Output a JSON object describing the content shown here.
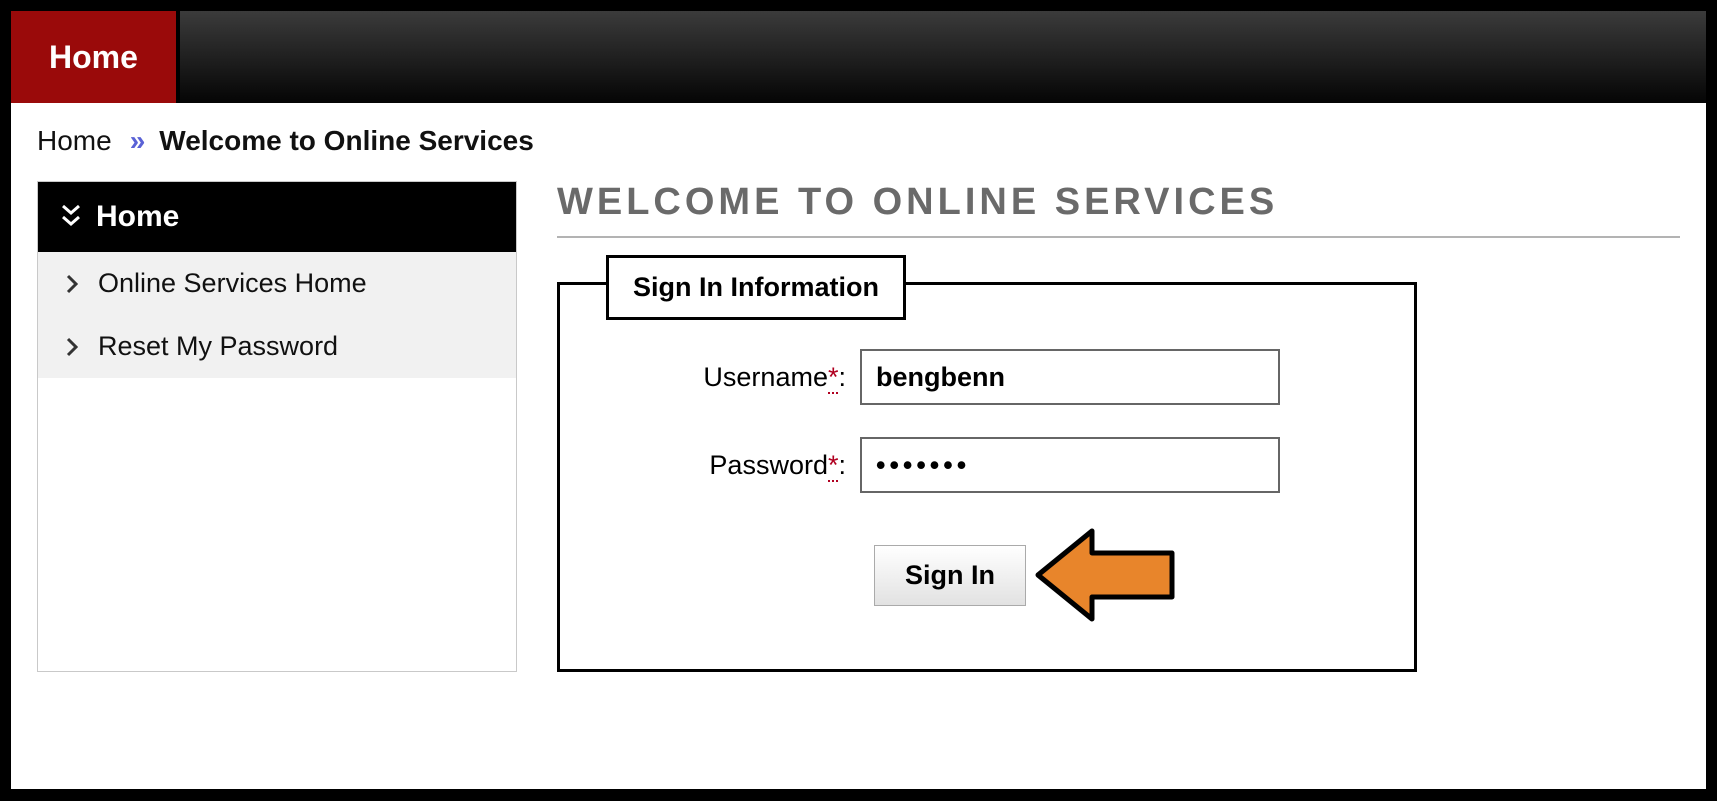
{
  "topbar": {
    "home_label": "Home"
  },
  "breadcrumb": {
    "root": "Home",
    "current": "Welcome to Online Services"
  },
  "sidebar": {
    "title": "Home",
    "items": [
      {
        "label": "Online Services Home"
      },
      {
        "label": "Reset My Password"
      }
    ]
  },
  "main": {
    "heading": "WELCOME TO ONLINE SERVICES",
    "panel_legend": "Sign In Information",
    "username_label": "Username",
    "password_label": "Password",
    "required_mark": "*",
    "colon": ":",
    "username_value": "bengbenn",
    "password_value": "•••••••",
    "signin_label": "Sign In"
  },
  "colors": {
    "accent_red": "#9a0a0a",
    "arrow_fill": "#e8852b"
  }
}
